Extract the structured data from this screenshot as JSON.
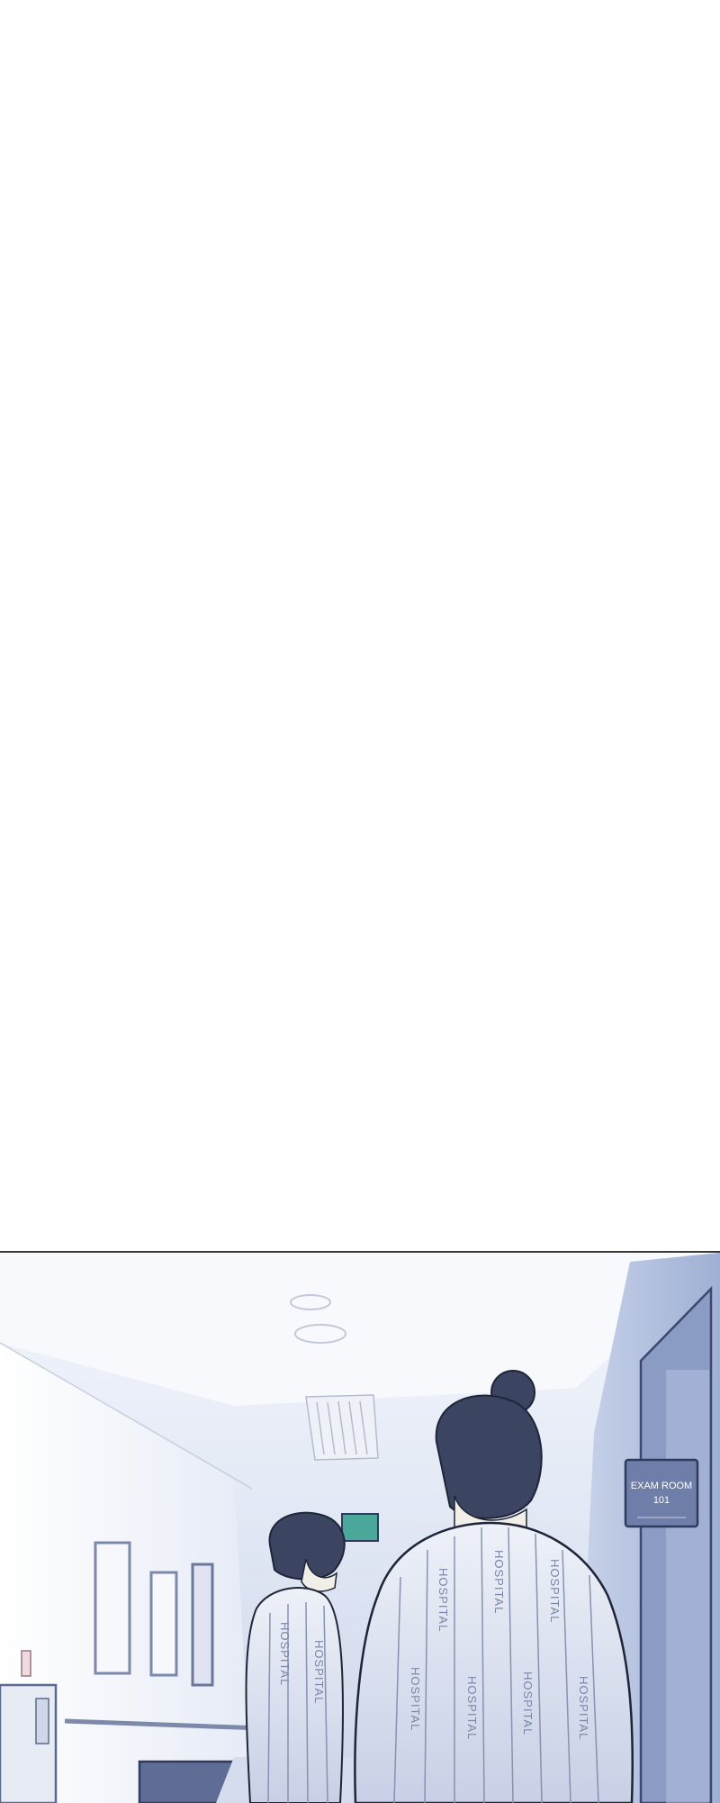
{
  "panel": {
    "door_sign": {
      "line1": "EXAM ROOM",
      "line2": "101"
    },
    "gown_text": "HOSPITAL"
  }
}
